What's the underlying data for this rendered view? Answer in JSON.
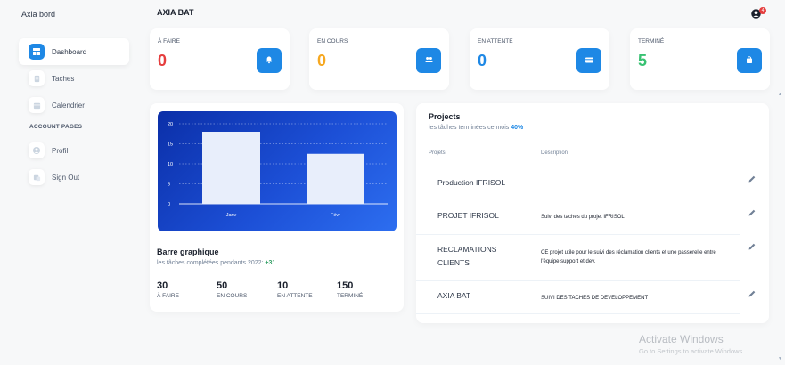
{
  "app": {
    "brand": "Axia bord",
    "page_title": "AXIA BAT"
  },
  "header": {
    "notification_count": "4"
  },
  "sidebar": {
    "items": [
      {
        "label": "Dashboard",
        "icon": "dashboard-icon",
        "active": true
      },
      {
        "label": "Taches",
        "icon": "list-icon"
      },
      {
        "label": "Calendrier",
        "icon": "calendar-icon"
      }
    ],
    "section_title": "ACCOUNT PAGES",
    "account_items": [
      {
        "label": "Profil",
        "icon": "user-icon"
      },
      {
        "label": "Sign Out",
        "icon": "sign-out-icon"
      }
    ]
  },
  "stats": [
    {
      "label": "À FAIRE",
      "value": "0",
      "color": "#e53e3e",
      "icon": "bell-icon"
    },
    {
      "label": "EN COURS",
      "value": "0",
      "color": "#f6a821",
      "icon": "users-icon"
    },
    {
      "label": "EN ATTENTE",
      "value": "0",
      "color": "#1e88e5",
      "icon": "card-icon"
    },
    {
      "label": "TERMINÉ",
      "value": "5",
      "color": "#38c172",
      "icon": "bag-icon"
    }
  ],
  "chart_card": {
    "heading": "Barre graphique",
    "subtitle": "les tâches complétées pendants 2022:",
    "delta": "+31",
    "mini_stats": [
      {
        "value": "30",
        "label": "À FAIRE"
      },
      {
        "value": "50",
        "label": "EN COURS"
      },
      {
        "value": "10",
        "label": "EN ATTENTE"
      },
      {
        "value": "150",
        "label": "TERMINÉ"
      }
    ]
  },
  "chart_data": {
    "type": "bar",
    "categories": [
      "Janv",
      "Févr"
    ],
    "values": [
      18,
      12.5
    ],
    "ylim": [
      0,
      20
    ],
    "yticks": [
      0,
      5,
      10,
      15,
      20
    ],
    "grid": true
  },
  "projects": {
    "title": "Projects",
    "subtitle": "les tâches terminées ce mois",
    "percent": "40%",
    "columns": [
      "Projets",
      "Description"
    ],
    "rows": [
      {
        "name": "Production IFRISOL",
        "description": ""
      },
      {
        "name": "PROJET IFRISOL",
        "description": "Suivi des taches du projet IFRISOL"
      },
      {
        "name": "RECLAMATIONS CLIENTS",
        "description": "CE projet utile pour le suivi des réclamation clients et une passerelle entre l'équipe support et dev."
      },
      {
        "name": "AXIA BAT",
        "description": "SUIVI DES TACHES DE DEVELOPPEMENT"
      }
    ]
  },
  "watermark": {
    "title": "Activate Windows",
    "subtitle": "Go to Settings to activate Windows."
  },
  "colors": {
    "accent": "#1e88e5",
    "text": "#2d3748",
    "background": "#f7f8f9"
  }
}
